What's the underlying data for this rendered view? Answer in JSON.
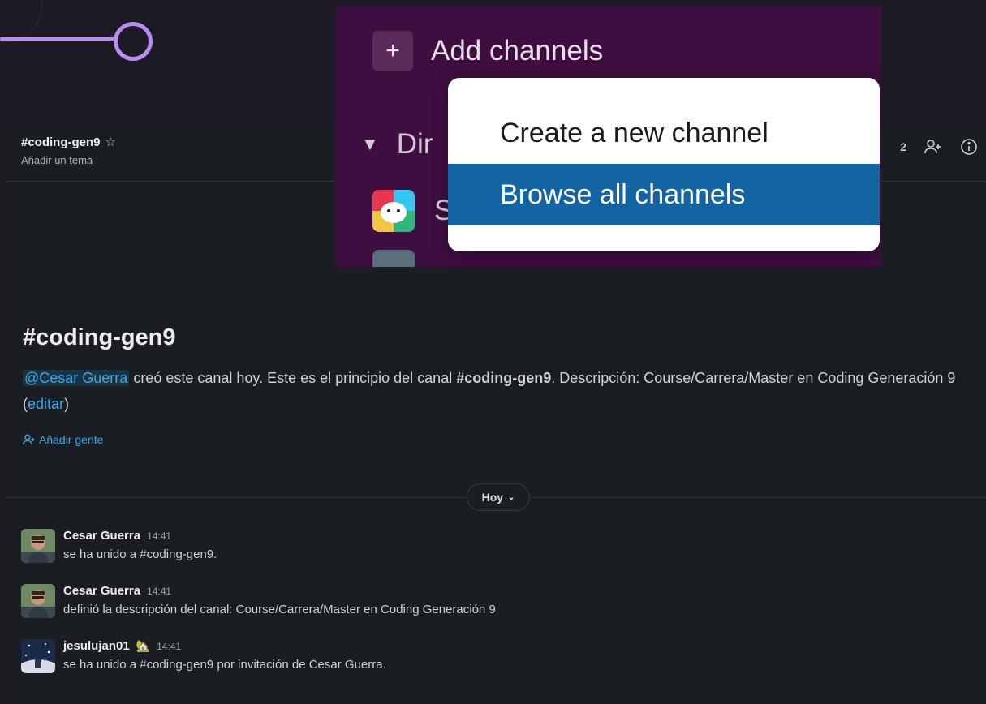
{
  "channel": {
    "name": "#coding-gen9",
    "topic": "Añadir un tema",
    "member_count": "2"
  },
  "intro": {
    "title": "#coding-gen9",
    "mention": "@Cesar Guerra",
    "text_part1": " creó este canal hoy. Este es el principio del canal ",
    "channel_bold": "#coding-gen9",
    "text_part2": ". Descripción: Course/Carrera/Master en Coding Generación 9 (",
    "edit_link": "editar",
    "text_part3": ")",
    "add_people": "Añadir gente"
  },
  "day_divider": "Hoy",
  "messages": [
    {
      "sender": "Cesar Guerra",
      "time": "14:41",
      "status_emoji": "",
      "body": "se ha unido a #coding-gen9."
    },
    {
      "sender": "Cesar Guerra",
      "time": "14:41",
      "status_emoji": "",
      "body": "definió la descripción del canal: Course/Carrera/Master en Coding Generación 9"
    },
    {
      "sender": "jesulujan01",
      "time": "14:41",
      "status_emoji": "🏡",
      "body": "se ha unido a #coding-gen9 por invitación de Cesar Guerra."
    }
  ],
  "sidebar_popup": {
    "add_channels": "Add channels",
    "plus": "+",
    "dm_section_partial": "Dir",
    "app_partial": "S",
    "menu": [
      {
        "label": "Create a new channel",
        "active": false
      },
      {
        "label": "Browse all channels",
        "active": true
      }
    ]
  },
  "colors": {
    "accent_link": "#3ea7e8",
    "sidebar_purple": "#3f0e40",
    "menu_highlight": "#1264a3",
    "background": "#1a1d21"
  }
}
